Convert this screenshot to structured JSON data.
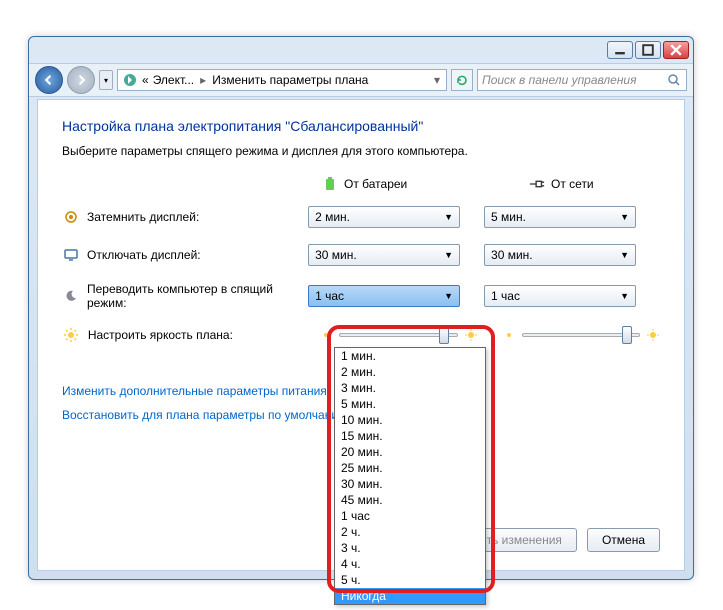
{
  "nav": {
    "crumb_prefix": "«",
    "crumb_parent": "Элект...",
    "crumb_current": "Изменить параметры плана",
    "search_placeholder": "Поиск в панели управления"
  },
  "page": {
    "title": "Настройка плана электропитания \"Сбалансированный\"",
    "subtitle": "Выберите параметры спящего режима и дисплея для этого компьютера."
  },
  "columns": {
    "battery": "От батареи",
    "ac": "От сети"
  },
  "rows": {
    "dim": {
      "label": "Затемнить дисплей:",
      "battery": "2 мин.",
      "ac": "5 мин."
    },
    "display": {
      "label": "Отключать дисплей:",
      "battery": "30 мин.",
      "ac": "30 мин."
    },
    "sleep": {
      "label": "Переводить компьютер в спящий режим:",
      "battery": "1 час",
      "ac": "1 час"
    },
    "brightness": {
      "label": "Настроить яркость плана:"
    }
  },
  "dropdown_options": [
    "1 мин.",
    "2 мин.",
    "3 мин.",
    "5 мин.",
    "10 мин.",
    "15 мин.",
    "20 мин.",
    "25 мин.",
    "30 мин.",
    "45 мин.",
    "1 час",
    "2 ч.",
    "3 ч.",
    "4 ч.",
    "5 ч.",
    "Никогда"
  ],
  "dropdown_selected": "Никогда",
  "links": {
    "advanced": "Изменить дополнительные параметры питания",
    "restore": "Восстановить для плана параметры по умолчанию"
  },
  "buttons": {
    "save": "Сохранить изменения",
    "cancel": "Отмена"
  }
}
